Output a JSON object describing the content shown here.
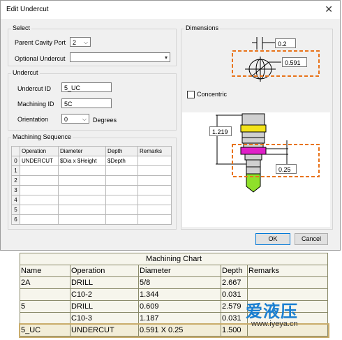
{
  "dialog": {
    "title": "Edit Undercut",
    "close_glyph": "✕",
    "select": {
      "legend": "Select",
      "parent_cavity_port_label": "Parent Cavity Port",
      "parent_cavity_port_value": "2",
      "optional_undercut_label": "Optional Undercut",
      "optional_undercut_value": ""
    },
    "undercut": {
      "legend": "Undercut",
      "undercut_id_label": "Undercut ID",
      "undercut_id_value": "5_UC",
      "machining_id_label": "Machining ID",
      "machining_id_value": "5C",
      "orientation_label": "Orientation",
      "orientation_value": "0",
      "degrees_label": "Degrees"
    },
    "machining_sequence": {
      "legend": "Machining Sequence",
      "columns": [
        "Operation",
        "Diameter",
        "Depth",
        "Remarks"
      ],
      "rows": [
        {
          "n": "0",
          "operation": "UNDERCUT",
          "diameter": "$Dia x $Height",
          "depth": "$Depth",
          "remarks": ""
        },
        {
          "n": "1",
          "operation": "",
          "diameter": "",
          "depth": "",
          "remarks": ""
        },
        {
          "n": "2",
          "operation": "",
          "diameter": "",
          "depth": "",
          "remarks": ""
        },
        {
          "n": "3",
          "operation": "",
          "diameter": "",
          "depth": "",
          "remarks": ""
        },
        {
          "n": "4",
          "operation": "",
          "diameter": "",
          "depth": "",
          "remarks": ""
        },
        {
          "n": "5",
          "operation": "",
          "diameter": "",
          "depth": "",
          "remarks": ""
        },
        {
          "n": "6",
          "operation": "",
          "diameter": "",
          "depth": "",
          "remarks": ""
        }
      ]
    },
    "dimensions": {
      "legend": "Dimensions",
      "width_value": "0.2",
      "dia_value": "0.591",
      "concentric_label": "Concentric",
      "length_value": "1.219",
      "depth_value": "0.25"
    },
    "ok_label": "OK",
    "cancel_label": "Cancel"
  },
  "machining_chart": {
    "title": "Machining Chart",
    "columns": [
      "Name",
      "Operation",
      "Diameter",
      "Depth",
      "Remarks"
    ],
    "rows": [
      {
        "name": "2A",
        "operation": "DRILL",
        "diameter": "5/8",
        "depth": "2.667",
        "remarks": ""
      },
      {
        "name": "",
        "operation": "C10-2",
        "diameter": "1.344",
        "depth": "0.031",
        "remarks": ""
      },
      {
        "name": "5",
        "operation": "DRILL",
        "diameter": "0.609",
        "depth": "2.579",
        "remarks": ""
      },
      {
        "name": "",
        "operation": "C10-3",
        "diameter": "1.187",
        "depth": "0.031",
        "remarks": ""
      },
      {
        "name": "5_UC",
        "operation": "UNDERCUT",
        "diameter": "0.591 X 0.25",
        "depth": "1.500",
        "remarks": ""
      }
    ]
  },
  "watermark": {
    "text": "爱液压",
    "url": "www.iyeya.cn"
  },
  "colors": {
    "accent": "#0078d7",
    "highlight_dash": "#e8731a",
    "magenta": "#e020c8",
    "yellow": "#f3e31a",
    "green": "#8fe02a"
  }
}
